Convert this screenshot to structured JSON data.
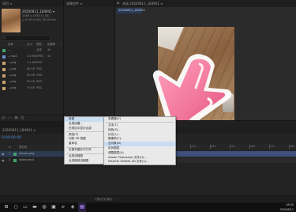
{
  "project": {
    "tab": "项目 ≡",
    "info_line1": "20200811_184941 ▾",
    "info_line2": "1080 x 1920 (1.00)",
    "info_line3": "△ 0:00:10:00, 30.00 fps",
    "search_icon": "search-icon",
    "columns": {
      "name": "名称",
      "size": "大小",
      "type": "类型",
      "extra": "帧速率"
    },
    "rows": [
      {
        "name": "...",
        "chip": "#3fa36a",
        "size": "",
        "type": "合成",
        "extra": "30"
      },
      {
        "name": "...mp4",
        "chip": "#6a8fd0",
        "size": "2.8 MB",
        "type": "MPEG",
        "extra": "30"
      },
      {
        "name": "...png",
        "chip": "#c8a36a",
        "size": "1.1 MB",
        "type": "PNG",
        "extra": ""
      },
      {
        "name": "...png",
        "chip": "#c8a36a",
        "size": "68 KB",
        "type": "PNG",
        "extra": ""
      },
      {
        "name": "...png",
        "chip": "#c8a36a",
        "size": "89 KB",
        "type": "PNG",
        "extra": ""
      },
      {
        "name": "...png",
        "chip": "#c8a36a",
        "size": "65 KB",
        "type": "PNG",
        "extra": ""
      },
      {
        "name": "...png",
        "chip": "#c8a36a",
        "size": "70 KB",
        "type": "PNG",
        "extra": ""
      }
    ]
  },
  "effects": {
    "tab": "效果控件 ≡"
  },
  "composition": {
    "tab": "合成 20200811_184941 ≡",
    "subtab": "20200811_184941",
    "lock_icon": "lock-icon"
  },
  "timeline": {
    "tab": "20200811_184941 ≡",
    "timecode": "0:00:00:00",
    "columns": {
      "layer": "#",
      "name": "源名称",
      "mode": "模式",
      "parent": "父级"
    },
    "rows": [
      {
        "num": "1",
        "name": "sticker.png"
      },
      {
        "num": "2",
        "name": "video.mp4"
      }
    ],
    "ruler": [
      "00s",
      "01s",
      "02s",
      "03s",
      "04s",
      "05s",
      "06s",
      "07s",
      "08s"
    ],
    "bottom_label": "切换开关/模式"
  },
  "context_menu": {
    "items": [
      {
        "label": "新建",
        "has_sub": true,
        "highlight": true
      },
      {
        "label": "合成设置..."
      },
      {
        "label": "在项目中显示合成"
      },
      {
        "sep": true
      },
      {
        "label": "预览(P)",
        "has_sub": true
      },
      {
        "label": "切换 3D 视图",
        "has_sub": true
      },
      {
        "label": "重命名"
      },
      {
        "sep": true
      },
      {
        "label": "在基本图形中打开"
      },
      {
        "sep": true
      },
      {
        "label": "合成流程图"
      },
      {
        "label": "合成微型流程图"
      }
    ]
  },
  "sub_menu": {
    "items": [
      {
        "label": "查看器(V)"
      },
      {
        "sep": true
      },
      {
        "label": "文本(T)"
      },
      {
        "label": "纯色(S)..."
      },
      {
        "label": "灯光(L)..."
      },
      {
        "label": "摄像机(C)..."
      },
      {
        "label": "空对象(N)",
        "highlight": true
      },
      {
        "label": "形状图层"
      },
      {
        "label": "调整图层(A)"
      },
      {
        "label": "Adobe Photoshop 文件(H)..."
      },
      {
        "label": "MAXON CINEMA 4D 文件(C)..."
      }
    ]
  },
  "taskbar": {
    "icons": [
      "windows-icon",
      "search-icon",
      "task-view-icon",
      "folder-icon",
      "browser-icon",
      "store-icon",
      "edge-icon",
      "app-icon",
      "ae-icon"
    ],
    "clock_time": "18:50",
    "clock_date": "2020/8/11"
  },
  "colors": {
    "accent": "#4f8fe0",
    "menu_bg": "#e9e9e9",
    "menu_highlight": "#c8dcf2",
    "arrow_pink": "#f07aa0"
  }
}
